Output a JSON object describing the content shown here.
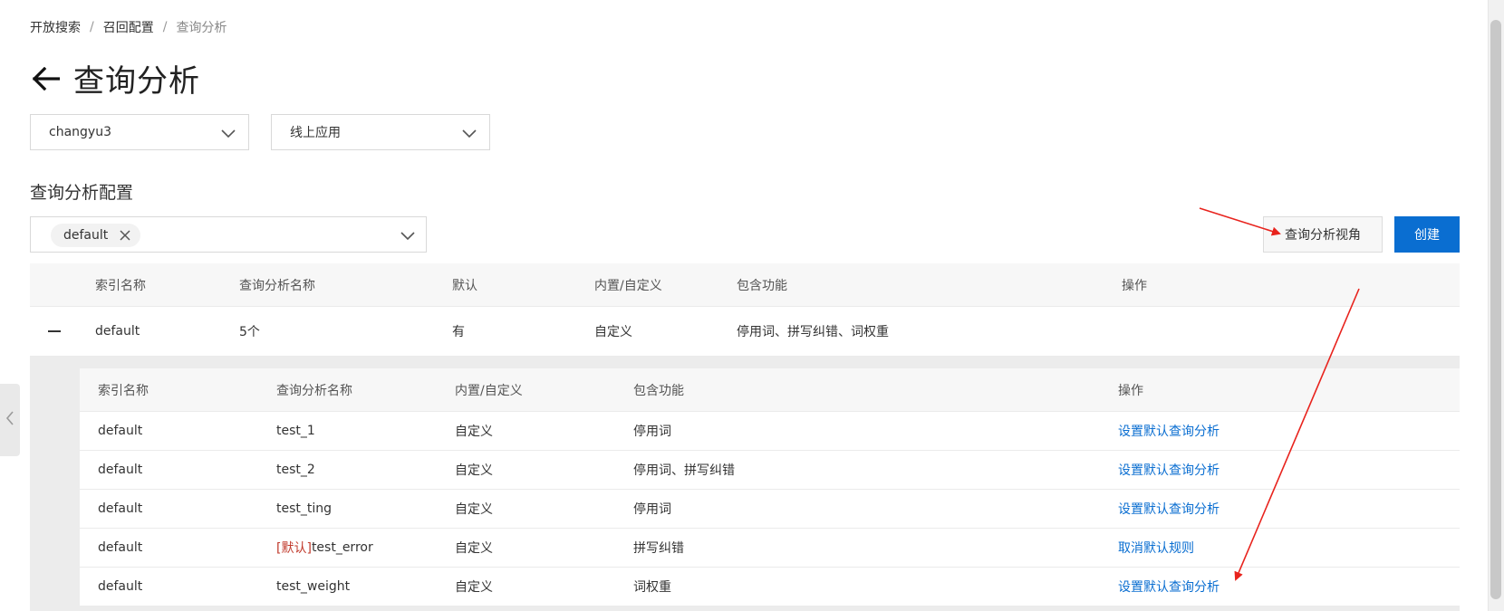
{
  "breadcrumb": {
    "item1": "开放搜索",
    "item2": "召回配置",
    "current": "查询分析",
    "sep": "/"
  },
  "page_title": "查询分析",
  "selectors": {
    "app_name": "changyu3",
    "app_version": "线上应用"
  },
  "section_label": "查询分析配置",
  "filter_tag": "default",
  "buttons": {
    "perspective": "查询分析视角",
    "create": "创建"
  },
  "outer_table": {
    "headers": {
      "index_name": "索引名称",
      "analysis_name": "查询分析名称",
      "default": "默认",
      "type": "内置/自定义",
      "features": "包含功能",
      "actions": "操作"
    },
    "row": {
      "index_name": "default",
      "analysis_name": "5个",
      "default": "有",
      "type": "自定义",
      "features": "停用词、拼写纠错、词权重"
    }
  },
  "inner_table": {
    "headers": {
      "index_name": "索引名称",
      "analysis_name": "查询分析名称",
      "type": "内置/自定义",
      "features": "包含功能",
      "actions": "操作"
    },
    "rows": [
      {
        "index_name": "default",
        "prefix": "",
        "analysis_name": "test_1",
        "type": "自定义",
        "features": "停用词",
        "action": "设置默认查询分析"
      },
      {
        "index_name": "default",
        "prefix": "",
        "analysis_name": "test_2",
        "type": "自定义",
        "features": "停用词、拼写纠错",
        "action": "设置默认查询分析"
      },
      {
        "index_name": "default",
        "prefix": "",
        "analysis_name": "test_ting",
        "type": "自定义",
        "features": "停用词",
        "action": "设置默认查询分析"
      },
      {
        "index_name": "default",
        "prefix": "[默认]",
        "analysis_name": "test_error",
        "type": "自定义",
        "features": "拼写纠错",
        "action": "取消默认规则"
      },
      {
        "index_name": "default",
        "prefix": "",
        "analysis_name": "test_weight",
        "type": "自定义",
        "features": "词权重",
        "action": "设置默认查询分析"
      }
    ]
  },
  "colors": {
    "primary": "#0a6ed1",
    "annotation": "#e8231d",
    "default_marker": "#c0392b"
  }
}
